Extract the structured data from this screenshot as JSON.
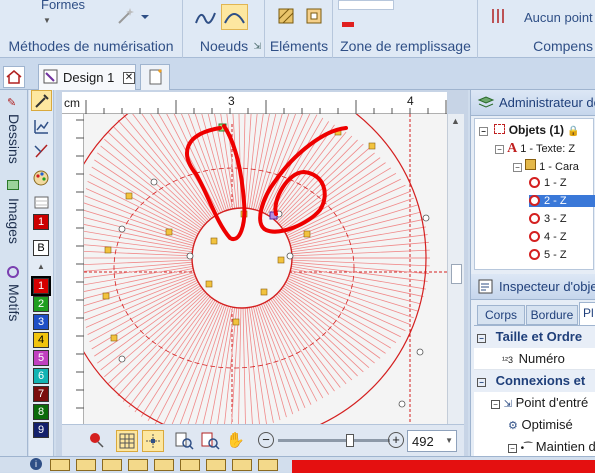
{
  "ribbon": {
    "formes_label": "Formes",
    "group_methodes": "Méthodes de numérisation",
    "group_noeuds": "Noeuds",
    "group_elements": "Eléments",
    "group_zone": "Zone de remplissage",
    "aucun_label": "Aucun point",
    "group_compens": "Compens"
  },
  "tabs": {
    "design_tab": "Design 1"
  },
  "leftbar": {
    "dessins": "Dessins",
    "images": "Images",
    "motifs": "Motifs"
  },
  "swatches": [
    {
      "label": "1",
      "color": "#cc0000"
    },
    {
      "label": "B",
      "color": "#ffffff"
    },
    {
      "label": "1",
      "color": "#d40000"
    },
    {
      "label": "2",
      "color": "#1f9e1f"
    },
    {
      "label": "3",
      "color": "#1e4fc6"
    },
    {
      "label": "4",
      "color": "#f1c40f"
    },
    {
      "label": "5",
      "color": "#c040c0"
    },
    {
      "label": "6",
      "color": "#12b3b3"
    },
    {
      "label": "7",
      "color": "#7a0d0d"
    },
    {
      "label": "8",
      "color": "#0b6b0b"
    },
    {
      "label": "9",
      "color": "#13206b"
    }
  ],
  "ruler": {
    "unit": "cm",
    "mark_3": "3",
    "mark_4": "4"
  },
  "zoom": {
    "value": "492"
  },
  "admin": {
    "title": "Administrateur de",
    "objets": "Objets (1)",
    "texte": "1 - Texte: Z",
    "cara": "1 - Cara",
    "items": [
      "1 - Z",
      "2 - Z",
      "3 - Z",
      "4 - Z",
      "5 - Z"
    ]
  },
  "inspector": {
    "title": "Inspecteur d'obje",
    "tabs": [
      "Corps",
      "Bordure",
      "Pl"
    ],
    "taille": "Taille et Ordre",
    "numero": "Numéro",
    "connexions": "Connexions et",
    "point_entree": "Point d'entré",
    "optimise": "Optimisé",
    "maintien": "Maintien d"
  },
  "colors": {
    "accent_red": "#e02020",
    "ribbon_blue": "#2f4f86",
    "highlight": "#fde7a0"
  }
}
